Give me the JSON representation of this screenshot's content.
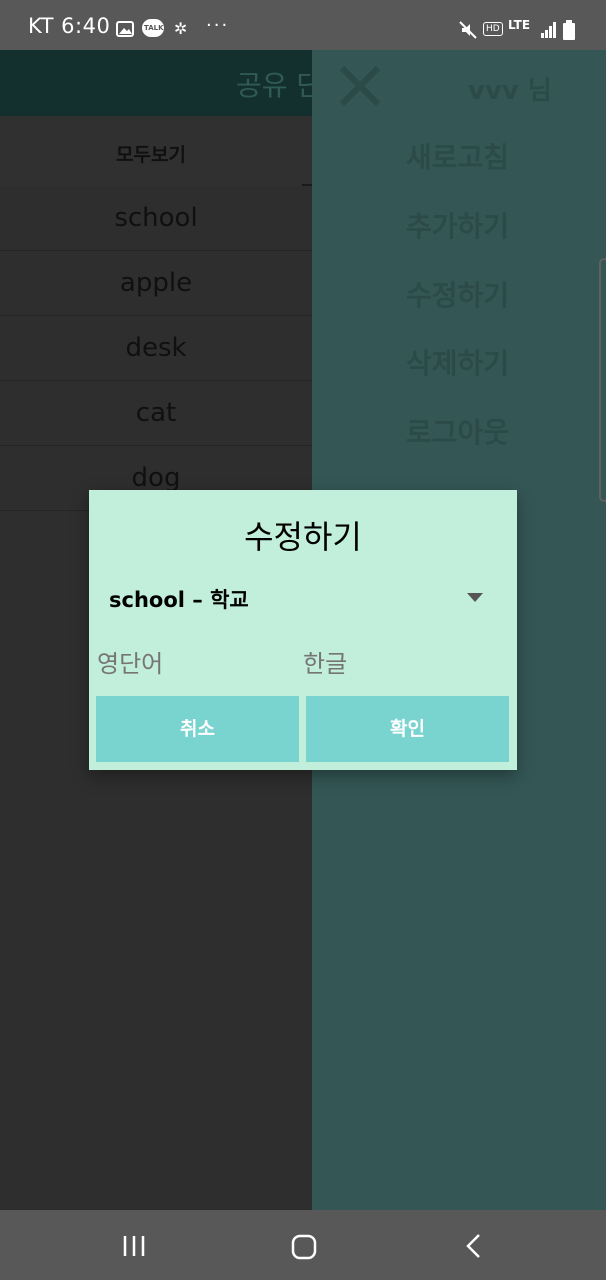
{
  "status_bar": {
    "time": "KT 6:40",
    "icons": [
      "gallery-icon",
      "kakaotalk-icon",
      "app-grid-icon",
      "more-dots-icon",
      "mute-icon",
      "hd-icon",
      "lte-icon",
      "signal-icon",
      "battery-icon"
    ],
    "talk_badge": "TALK",
    "hd_badge": "HD",
    "network": "LTE"
  },
  "app": {
    "title": "공유 단",
    "tab": "모두보기",
    "words": [
      "school",
      "apple",
      "desk",
      "cat",
      "dog"
    ]
  },
  "drawer": {
    "user": "vvv 님",
    "menu": [
      "새로고침",
      "추가하기",
      "수정하기",
      "삭제하기",
      "로그아웃"
    ]
  },
  "dialog": {
    "title": "수정하기",
    "selected": "school – 학교",
    "english_placeholder": "영단어",
    "korean_placeholder": "한글",
    "cancel": "취소",
    "confirm": "확인"
  },
  "colors": {
    "drawer": "#345756",
    "dialog": "#c2eedc",
    "button": "#79d4d0"
  }
}
